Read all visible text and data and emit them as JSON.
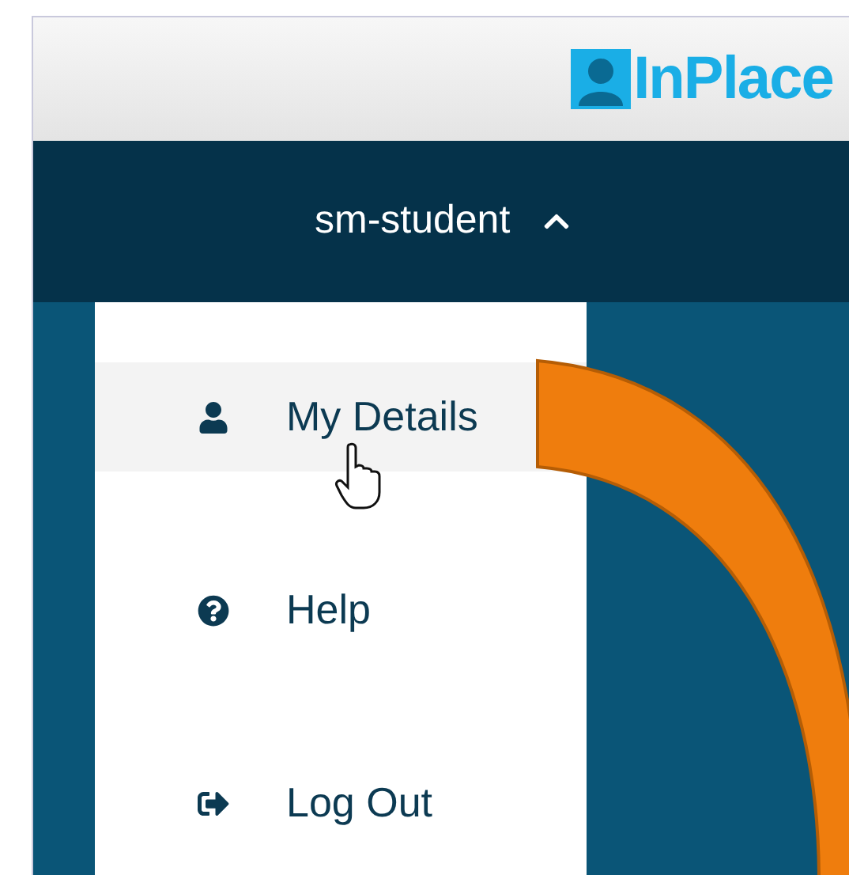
{
  "logo": {
    "text": "InPlace"
  },
  "user_menu": {
    "username": "sm-student",
    "expanded": true
  },
  "menu_items": [
    {
      "label": "My Details",
      "kind": "details",
      "hovered": true
    },
    {
      "label": "Help",
      "kind": "help",
      "hovered": false
    },
    {
      "label": "Log Out",
      "kind": "logout",
      "hovered": false
    }
  ]
}
